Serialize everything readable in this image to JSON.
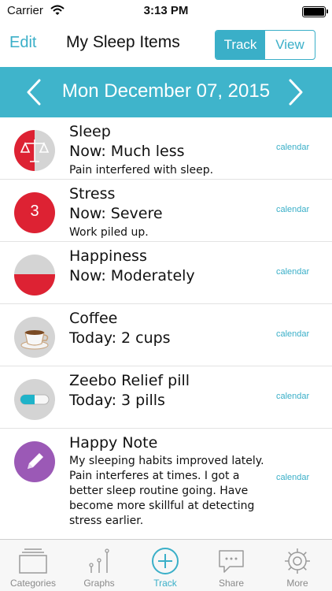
{
  "status_bar": {
    "carrier": "Carrier",
    "time": "3:13 PM",
    "wifi_icon": "wifi-icon",
    "battery_icon": "battery-icon"
  },
  "nav": {
    "edit_label": "Edit",
    "title": "My Sleep Items",
    "segments": [
      {
        "label": "Track",
        "active": true
      },
      {
        "label": "View",
        "active": false
      }
    ]
  },
  "date_bar": {
    "prev_icon": "chevron-left-icon",
    "date": "Mon December 07, 2015",
    "next_icon": "chevron-right-icon"
  },
  "items": [
    {
      "name": "Sleep",
      "value": "Now: Much less",
      "note": "Pain interfered with sleep.",
      "calendar_label": "calendar",
      "icon": "scale-icon"
    },
    {
      "name": "Stress",
      "value": "Now: Severe",
      "note": "Work piled up.",
      "calendar_label": "calendar",
      "icon": "level-badge-icon",
      "badge": "3"
    },
    {
      "name": "Happiness",
      "value": "Now: Moderately",
      "note": "",
      "calendar_label": "calendar",
      "icon": "half-filled-circle-icon"
    },
    {
      "name": "Coffee",
      "value": "Today: 2 cups",
      "note": "",
      "calendar_label": "calendar",
      "icon": "coffee-cup-icon"
    },
    {
      "name": "Zeebo Relief pill",
      "value": "Today: 3 pills",
      "note": "",
      "calendar_label": "calendar",
      "icon": "pill-icon"
    },
    {
      "name": "Happy Note",
      "value": "",
      "note": "My sleeping habits improved lately. Pain interferes at times. I got a better sleep routine going. Have become more skillful at detecting stress earlier.",
      "calendar_label": "calendar",
      "icon": "pencil-icon"
    }
  ],
  "tabs": [
    {
      "label": "Categories",
      "icon": "folder-icon",
      "active": false
    },
    {
      "label": "Graphs",
      "icon": "graph-icon",
      "active": false
    },
    {
      "label": "Track",
      "icon": "plus-circle-icon",
      "active": true
    },
    {
      "label": "Share",
      "icon": "speech-bubble-icon",
      "active": false
    },
    {
      "label": "More",
      "icon": "gear-icon",
      "active": false
    }
  ],
  "colors": {
    "accent": "#3aafc8",
    "date_bar": "#3fb4cb",
    "alert_red": "#dd2233",
    "note_purple": "#9b59b6"
  }
}
